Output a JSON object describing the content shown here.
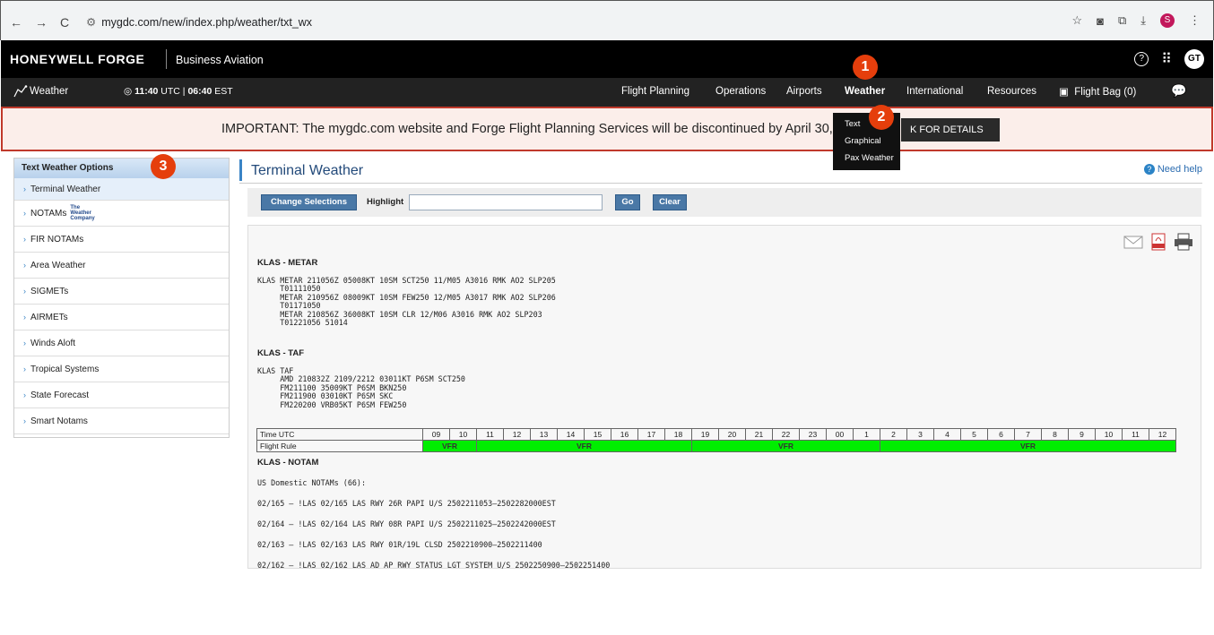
{
  "browser": {
    "back": "←",
    "forward": "→",
    "reload": "C",
    "url": "mygdc.com/new/index.php/weather/txt_wx",
    "avatar": "S"
  },
  "header": {
    "brand": "HONEYWELL FORGE",
    "product": "Business Aviation",
    "help": "?",
    "apps": "⠿",
    "user_initials": "GT"
  },
  "nav": {
    "weather": "Weather",
    "time_utc": "11:40",
    "utc_label": "UTC",
    "time_est": "06:40",
    "est_label": "EST",
    "items": [
      "Flight Planning",
      "Operations",
      "Airports",
      "Weather",
      "International",
      "Resources",
      "Flight Bag (0)"
    ]
  },
  "weather_menu": [
    "Text",
    "Graphical",
    "Pax Weather"
  ],
  "markers": [
    "1",
    "2",
    "3"
  ],
  "banner": {
    "text": "IMPORTANT: The mygdc.com website and Forge Flight Planning Services will be discontinued by April 30, 20",
    "button": "K FOR DETAILS"
  },
  "sidebar": {
    "title": "Text Weather Options",
    "items": [
      "Terminal Weather",
      "NOTAMs",
      "FIR NOTAMs",
      "Area Weather",
      "SIGMETs",
      "AIRMETs",
      "Winds Aloft",
      "Tropical Systems",
      "State Forecast",
      "Smart Notams"
    ],
    "twc_logo": [
      "The",
      "Weather",
      "Company"
    ]
  },
  "main": {
    "title": "Terminal Weather",
    "help": "Need help",
    "change_selections": "Change Selections",
    "highlight_label": "Highlight",
    "highlight_value": "",
    "go": "Go",
    "clear": "Clear"
  },
  "report": {
    "metar_title": "KLAS - METAR",
    "metar_text": "KLAS METAR 211056Z 05008KT 10SM SCT250 11/M05 A3016 RMK AO2 SLP205\n     T01111050\n     METAR 210956Z 08009KT 10SM FEW250 12/M05 A3017 RMK AO2 SLP206\n     T01171050\n     METAR 210856Z 36008KT 10SM CLR 12/M06 A3016 RMK AO2 SLP203\n     T01221056 51014",
    "taf_title": "KLAS - TAF",
    "taf_text": "KLAS TAF\n     AMD 210832Z 2109/2212 03011KT P6SM SCT250\n     FM211100 35009KT P6SM BKN250\n     FM211900 03010KT P6SM SKC\n     FM220200 VRB05KT P6SM FEW250",
    "table": {
      "time_label": "Time UTC",
      "rule_label": "Flight Rule",
      "hours": [
        "09",
        "10",
        "11",
        "12",
        "13",
        "14",
        "15",
        "16",
        "17",
        "18",
        "19",
        "20",
        "21",
        "22",
        "23",
        "00",
        "1",
        "2",
        "3",
        "4",
        "5",
        "6",
        "7",
        "8",
        "9",
        "10",
        "11",
        "12"
      ],
      "rules": [
        {
          "label": "VFR",
          "span": 2
        },
        {
          "label": "VFR",
          "span": 8
        },
        {
          "label": "VFR",
          "span": 7
        },
        {
          "label": "VFR",
          "span": 11
        }
      ]
    },
    "notam_title": "KLAS - NOTAM",
    "notam_count": "US Domestic NOTAMs (66):",
    "notams": [
      "02/165 – !LAS 02/165 LAS RWY 26R PAPI U/S 2502211053–2502282000EST",
      "02/164 – !LAS 02/164 LAS RWY 08R PAPI U/S 2502211025–2502242000EST",
      "02/163 – !LAS 02/163 LAS RWY 01R/19L CLSD 2502210900–2502211400",
      "02/162 – !LAS 02/162 LAS AD AP RWY STATUS LGT SYSTEM U/S 2502250900–2502251400"
    ]
  },
  "colors": {
    "accent": "#3a84c6",
    "vfr": "#00ee00",
    "marker": "#e53e0c",
    "banner_border": "#c0392b"
  }
}
